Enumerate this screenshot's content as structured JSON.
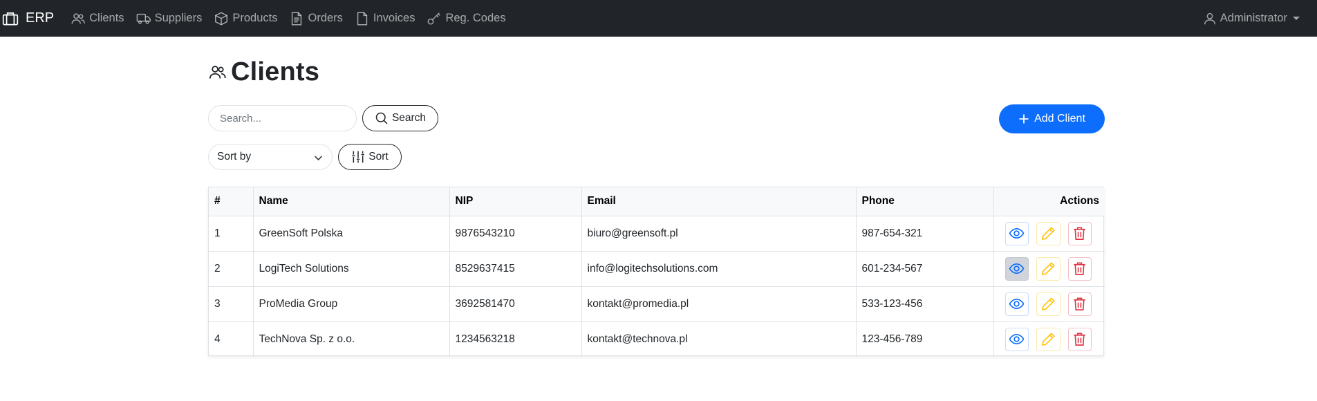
{
  "app": {
    "brand": "ERP"
  },
  "nav": [
    {
      "label": "Clients",
      "icon": "people-icon"
    },
    {
      "label": "Suppliers",
      "icon": "truck-icon"
    },
    {
      "label": "Products",
      "icon": "box-icon"
    },
    {
      "label": "Orders",
      "icon": "file-text-icon"
    },
    {
      "label": "Invoices",
      "icon": "file-icon"
    },
    {
      "label": "Reg. Codes",
      "icon": "key-icon"
    }
  ],
  "user": {
    "label": "Administrator"
  },
  "page": {
    "title": "Clients"
  },
  "search": {
    "placeholder": "Search...",
    "button": "Search"
  },
  "sort": {
    "selected": "Sort by",
    "button": "Sort"
  },
  "add_button": "Add Client",
  "table": {
    "headers": [
      "#",
      "Name",
      "NIP",
      "Email",
      "Phone",
      "Actions"
    ],
    "rows": [
      {
        "num": "1",
        "name": "GreenSoft Polska",
        "nip": "9876543210",
        "email": "biuro@greensoft.pl",
        "phone": "987-654-321"
      },
      {
        "num": "2",
        "name": "LogiTech Solutions",
        "nip": "8529637415",
        "email": "info@logitechsolutions.com",
        "phone": "601-234-567"
      },
      {
        "num": "3",
        "name": "ProMedia Group",
        "nip": "3692581470",
        "email": "kontakt@promedia.pl",
        "phone": "533-123-456"
      },
      {
        "num": "4",
        "name": "TechNova Sp. z o.o.",
        "nip": "1234563218",
        "email": "kontakt@technova.pl",
        "phone": "123-456-789"
      }
    ]
  },
  "colors": {
    "navbar": "#212529",
    "primary": "#0d6efd",
    "warning": "#ffc107",
    "danger": "#dc3545"
  }
}
